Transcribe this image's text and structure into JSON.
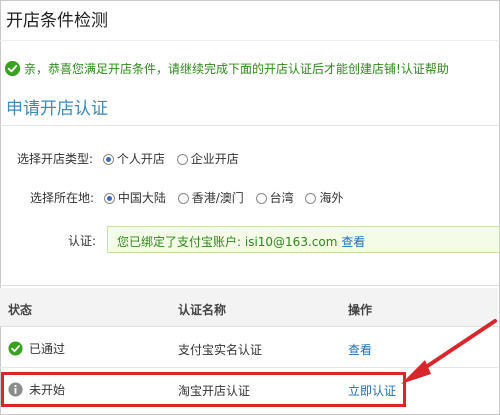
{
  "page": {
    "title": "开店条件检测"
  },
  "notice": {
    "text": "亲，恭喜您满足开店条件，请继续完成下面的开店认证后才能创建店铺!",
    "help_link": "认证帮助"
  },
  "section": {
    "title": "申请开店认证"
  },
  "form": {
    "shop_type": {
      "label": "选择开店类型:",
      "options": [
        {
          "label": "个人开店",
          "checked": true
        },
        {
          "label": "企业开店",
          "checked": false
        }
      ]
    },
    "location": {
      "label": "选择所在地:",
      "options": [
        {
          "label": "中国大陆",
          "checked": true
        },
        {
          "label": "香港/澳门",
          "checked": false
        },
        {
          "label": "台湾",
          "checked": false
        },
        {
          "label": "海外",
          "checked": false
        }
      ]
    },
    "certification": {
      "label": "认证:",
      "text": "您已绑定了支付宝账户: isi10@163.com",
      "view_link": "查看"
    }
  },
  "table": {
    "headers": [
      "状态",
      "认证名称",
      "操作"
    ],
    "rows": [
      {
        "status": "已通过",
        "status_icon": "check-circle-icon",
        "name": "支付宝实名认证",
        "action": "查看"
      },
      {
        "status": "未开始",
        "status_icon": "info-circle-icon",
        "name": "淘宝开店认证",
        "action": "立即认证"
      }
    ]
  },
  "annotation": {
    "highlight_color": "#d8262c"
  },
  "colors": {
    "success": "#2f8a1c",
    "link": "#1f6fb5",
    "section_title": "#3b8bbd"
  }
}
